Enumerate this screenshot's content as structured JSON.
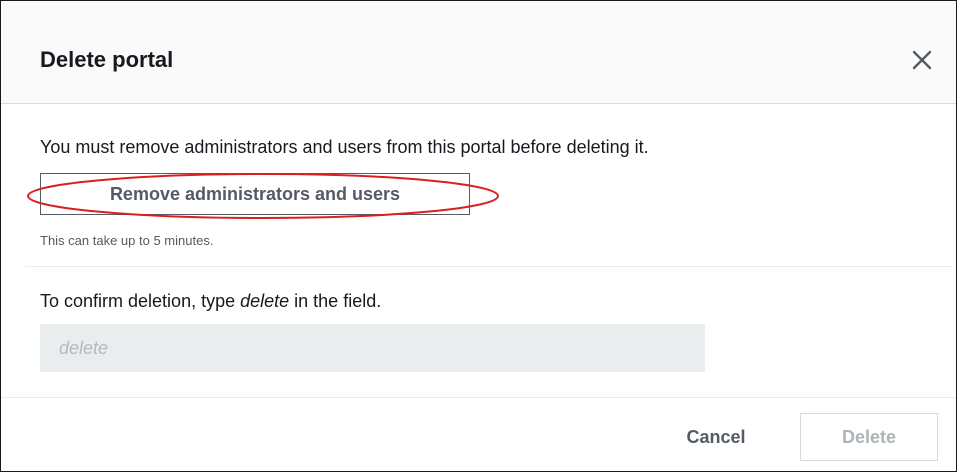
{
  "dialog": {
    "title": "Delete portal",
    "close_icon": "close-icon"
  },
  "remove_section": {
    "message": "You must remove administrators and users from this portal before deleting it.",
    "button_label": "Remove administrators and users",
    "hint": "This can take up to 5 minutes.",
    "highlight_color": "#d92020"
  },
  "confirm_section": {
    "label_prefix": "To confirm deletion, type ",
    "label_keyword": "delete",
    "label_suffix": " in the field.",
    "input_value": "",
    "input_placeholder": "delete"
  },
  "footer": {
    "cancel_label": "Cancel",
    "delete_label": "Delete",
    "delete_disabled": true
  },
  "colors": {
    "text_primary": "#16191f",
    "text_secondary": "#545b64",
    "disabled_text": "#aab7b8",
    "input_background": "#eaeded",
    "header_background": "#fafafa"
  }
}
